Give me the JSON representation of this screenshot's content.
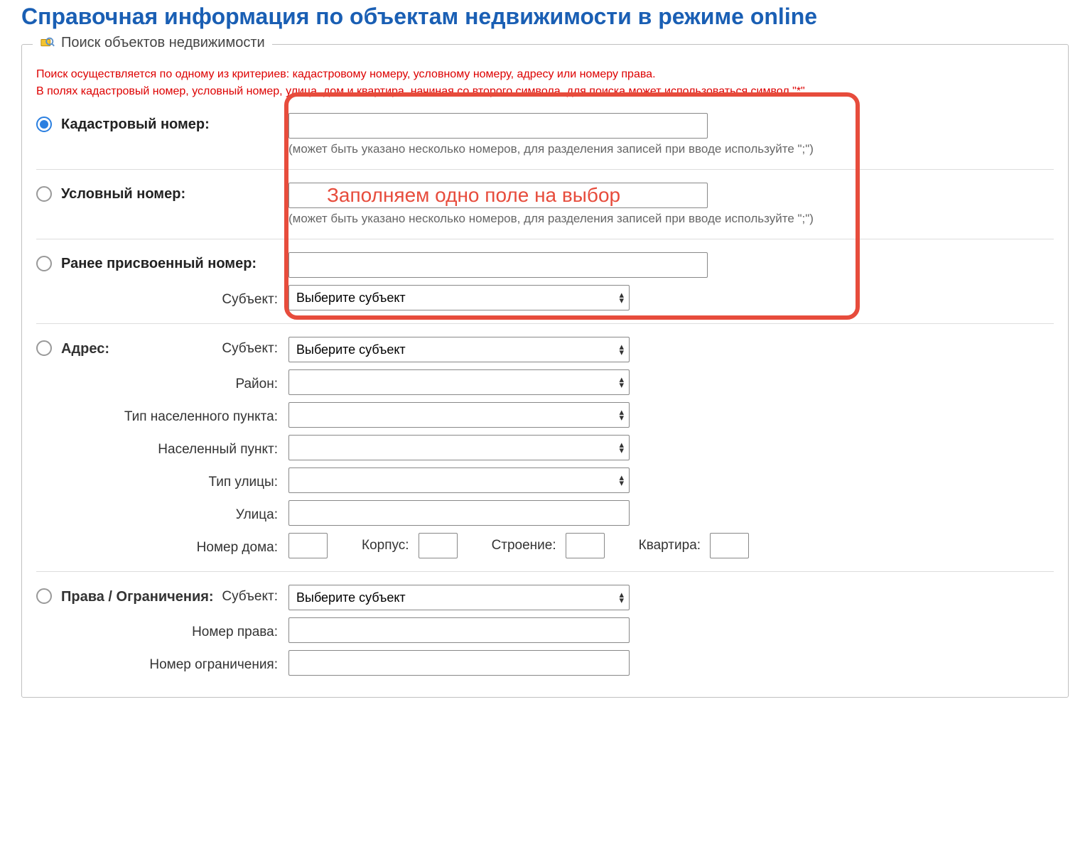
{
  "page": {
    "title": "Справочная информация по объектам недвижимости в режиме online"
  },
  "legend": "Поиск объектов недвижимости",
  "info": {
    "line1": "Поиск осуществляется по одному из критериев: кадастровому номеру, условному номеру, адресу или номеру права.",
    "line2": "В полях кадастровый номер, условный номер, улица, дом и квартира, начиная со второго символа, для поиска может использоваться символ \"*\"."
  },
  "annotation": "Заполняем одно поле на выбор",
  "fields": {
    "cadastral": {
      "label": "Кадастровый номер:",
      "hint": "(может быть указано несколько номеров, для разделения записей при вводе используйте \";\")"
    },
    "conditional": {
      "label": "Условный номер:",
      "hint": "(может быть указано несколько номеров, для разделения записей при вводе используйте \";\")"
    },
    "prev": {
      "label": "Ранее присвоенный номер:",
      "subject_label": "Субъект:",
      "subject_option": "Выберите субъект"
    },
    "address": {
      "label": "Адрес:",
      "subject_label": "Субъект:",
      "subject_option": "Выберите субъект",
      "district_label": "Район:",
      "settlement_type_label": "Тип населенного пункта:",
      "settlement_label": "Населенный пункт:",
      "street_type_label": "Тип улицы:",
      "street_label": "Улица:",
      "house_label": "Номер дома:",
      "corpus_label": "Корпус:",
      "building_label": "Строение:",
      "flat_label": "Квартира:"
    },
    "rights": {
      "label": "Права / Ограничения:",
      "subject_label": "Субъект:",
      "subject_option": "Выберите субъект",
      "right_num_label": "Номер права:",
      "restriction_num_label": "Номер ограничения:"
    }
  }
}
